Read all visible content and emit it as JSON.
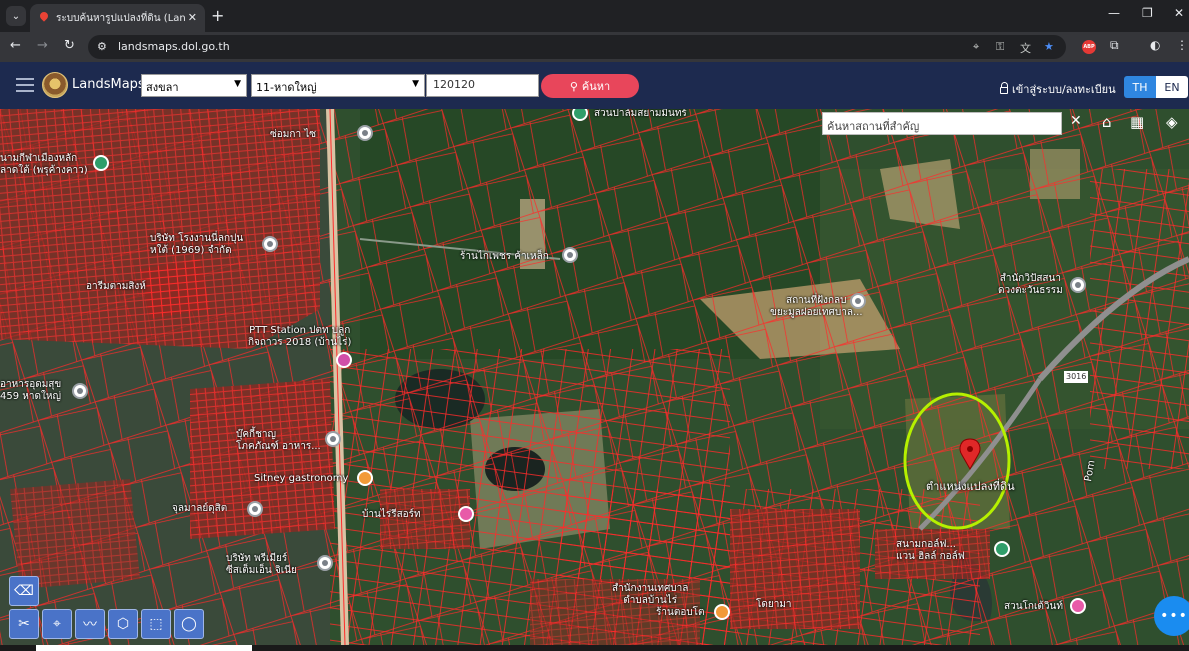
{
  "browser": {
    "tab_title": "ระบบค้นหารูปแปลงที่ดิน (LandsMaps",
    "tab_close": "✕",
    "new_tab": "+",
    "url": "landsmaps.dol.go.th",
    "window_controls": [
      "—",
      "❐",
      "✕"
    ]
  },
  "header": {
    "brand": "LandsMaps",
    "province": "สงขลา",
    "district": "11-หาดใหญ่",
    "parcel_number": "120120",
    "search_label": "ค้นหา",
    "login_label": "เข้าสู่ระบบ/ลงทะเบียน",
    "lang_th": "TH",
    "lang_en": "EN"
  },
  "map": {
    "place_search_placeholder": "ค้นหาสถานที่สำคัญ",
    "marker_label": "ตำแหน่งแปลงที่ดิน",
    "highlight_color": "#b6f000",
    "parcel_line_color": "#ff2a2a",
    "pois": [
      {
        "text": "สวนปาล์มสยามมินทร์"
      },
      {
        "text": "ซ่อมกา ไซ"
      },
      {
        "text": "นามกีฬาเมืองหลัก\nลาดใต้ (พรุค้างคาว)"
      },
      {
        "text": "บริษัท โรงงานนี่ลกปุน\nหใต้ (1969) จำกัด"
      },
      {
        "text": "อารีมตามสิงห์"
      },
      {
        "text": "ร้านไกเพชร ค้าเหล็ก"
      },
      {
        "text": "สถานที่ฝังกลบ\nขยะมูลฝอยเทศบาล..."
      },
      {
        "text": "สำนักวิปัสสนา\nดวงตะวันธรรม"
      },
      {
        "text": "PTT Station ปตท บลูก\nกิจถาวร 2018 (บ้านไร่)"
      },
      {
        "text": "อาหารอุดมสุข\n459 หาดใหญ่"
      },
      {
        "text": "บุ๊คกี้ชาญ\nโภคภัณฑ์ อาหาร..."
      },
      {
        "text": "Sitney gastronomy"
      },
      {
        "text": "จุลมาลย์ดุสิต"
      },
      {
        "text": "บ้านไร่รีสอร์ท"
      },
      {
        "text": "บริษัท พรีเมียร์\nซีสเต็มเอ็น จิเนีย"
      },
      {
        "text": "สนามกอล์ฟ...\nแวน ฮิลล์ กอล์ฟ"
      },
      {
        "text": "สำนักงานเทศบาล\nตำบลบ้านไร่"
      },
      {
        "text": "ร้านตอบโต"
      },
      {
        "text": "โดยามา"
      },
      {
        "text": "สวนโกเต้วินท์"
      },
      {
        "text": "Pom"
      },
      {
        "text": "3016"
      }
    ]
  },
  "tools": [
    {
      "name": "eraser",
      "glyph": "⌫"
    },
    {
      "name": "measure",
      "glyph": "✂"
    },
    {
      "name": "pin",
      "glyph": "⌖"
    },
    {
      "name": "line",
      "glyph": "〰"
    },
    {
      "name": "polygon",
      "glyph": "⬡"
    },
    {
      "name": "rectangle",
      "glyph": "⬚"
    },
    {
      "name": "circle",
      "glyph": "◯"
    }
  ],
  "chat_glyph": "•••"
}
